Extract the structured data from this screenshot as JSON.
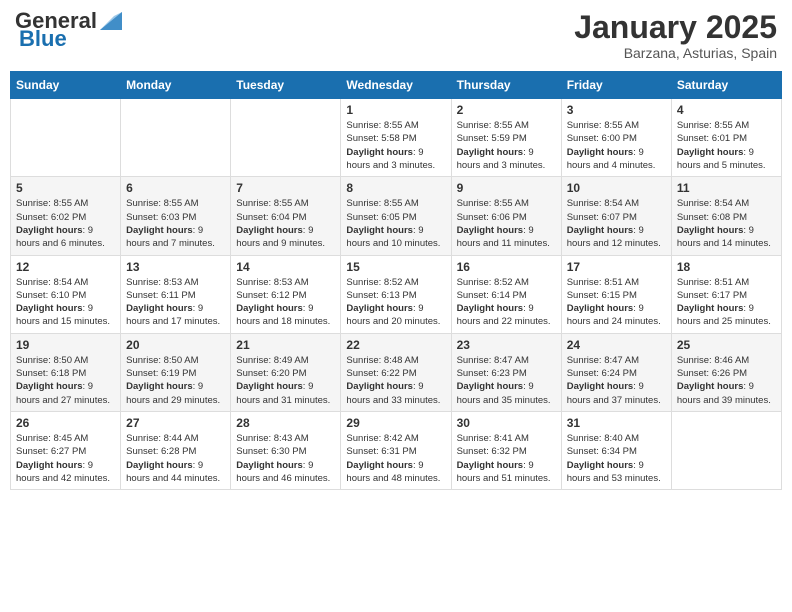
{
  "header": {
    "logo_general": "General",
    "logo_blue": "Blue",
    "month_title": "January 2025",
    "location": "Barzana, Asturias, Spain"
  },
  "calendar": {
    "days_of_week": [
      "Sunday",
      "Monday",
      "Tuesday",
      "Wednesday",
      "Thursday",
      "Friday",
      "Saturday"
    ],
    "weeks": [
      [
        {
          "day": "",
          "info": ""
        },
        {
          "day": "",
          "info": ""
        },
        {
          "day": "",
          "info": ""
        },
        {
          "day": "1",
          "info": "Sunrise: 8:55 AM\nSunset: 5:58 PM\nDaylight: 9 hours and 3 minutes."
        },
        {
          "day": "2",
          "info": "Sunrise: 8:55 AM\nSunset: 5:59 PM\nDaylight: 9 hours and 3 minutes."
        },
        {
          "day": "3",
          "info": "Sunrise: 8:55 AM\nSunset: 6:00 PM\nDaylight: 9 hours and 4 minutes."
        },
        {
          "day": "4",
          "info": "Sunrise: 8:55 AM\nSunset: 6:01 PM\nDaylight: 9 hours and 5 minutes."
        }
      ],
      [
        {
          "day": "5",
          "info": "Sunrise: 8:55 AM\nSunset: 6:02 PM\nDaylight: 9 hours and 6 minutes."
        },
        {
          "day": "6",
          "info": "Sunrise: 8:55 AM\nSunset: 6:03 PM\nDaylight: 9 hours and 7 minutes."
        },
        {
          "day": "7",
          "info": "Sunrise: 8:55 AM\nSunset: 6:04 PM\nDaylight: 9 hours and 9 minutes."
        },
        {
          "day": "8",
          "info": "Sunrise: 8:55 AM\nSunset: 6:05 PM\nDaylight: 9 hours and 10 minutes."
        },
        {
          "day": "9",
          "info": "Sunrise: 8:55 AM\nSunset: 6:06 PM\nDaylight: 9 hours and 11 minutes."
        },
        {
          "day": "10",
          "info": "Sunrise: 8:54 AM\nSunset: 6:07 PM\nDaylight: 9 hours and 12 minutes."
        },
        {
          "day": "11",
          "info": "Sunrise: 8:54 AM\nSunset: 6:08 PM\nDaylight: 9 hours and 14 minutes."
        }
      ],
      [
        {
          "day": "12",
          "info": "Sunrise: 8:54 AM\nSunset: 6:10 PM\nDaylight: 9 hours and 15 minutes."
        },
        {
          "day": "13",
          "info": "Sunrise: 8:53 AM\nSunset: 6:11 PM\nDaylight: 9 hours and 17 minutes."
        },
        {
          "day": "14",
          "info": "Sunrise: 8:53 AM\nSunset: 6:12 PM\nDaylight: 9 hours and 18 minutes."
        },
        {
          "day": "15",
          "info": "Sunrise: 8:52 AM\nSunset: 6:13 PM\nDaylight: 9 hours and 20 minutes."
        },
        {
          "day": "16",
          "info": "Sunrise: 8:52 AM\nSunset: 6:14 PM\nDaylight: 9 hours and 22 minutes."
        },
        {
          "day": "17",
          "info": "Sunrise: 8:51 AM\nSunset: 6:15 PM\nDaylight: 9 hours and 24 minutes."
        },
        {
          "day": "18",
          "info": "Sunrise: 8:51 AM\nSunset: 6:17 PM\nDaylight: 9 hours and 25 minutes."
        }
      ],
      [
        {
          "day": "19",
          "info": "Sunrise: 8:50 AM\nSunset: 6:18 PM\nDaylight: 9 hours and 27 minutes."
        },
        {
          "day": "20",
          "info": "Sunrise: 8:50 AM\nSunset: 6:19 PM\nDaylight: 9 hours and 29 minutes."
        },
        {
          "day": "21",
          "info": "Sunrise: 8:49 AM\nSunset: 6:20 PM\nDaylight: 9 hours and 31 minutes."
        },
        {
          "day": "22",
          "info": "Sunrise: 8:48 AM\nSunset: 6:22 PM\nDaylight: 9 hours and 33 minutes."
        },
        {
          "day": "23",
          "info": "Sunrise: 8:47 AM\nSunset: 6:23 PM\nDaylight: 9 hours and 35 minutes."
        },
        {
          "day": "24",
          "info": "Sunrise: 8:47 AM\nSunset: 6:24 PM\nDaylight: 9 hours and 37 minutes."
        },
        {
          "day": "25",
          "info": "Sunrise: 8:46 AM\nSunset: 6:26 PM\nDaylight: 9 hours and 39 minutes."
        }
      ],
      [
        {
          "day": "26",
          "info": "Sunrise: 8:45 AM\nSunset: 6:27 PM\nDaylight: 9 hours and 42 minutes."
        },
        {
          "day": "27",
          "info": "Sunrise: 8:44 AM\nSunset: 6:28 PM\nDaylight: 9 hours and 44 minutes."
        },
        {
          "day": "28",
          "info": "Sunrise: 8:43 AM\nSunset: 6:30 PM\nDaylight: 9 hours and 46 minutes."
        },
        {
          "day": "29",
          "info": "Sunrise: 8:42 AM\nSunset: 6:31 PM\nDaylight: 9 hours and 48 minutes."
        },
        {
          "day": "30",
          "info": "Sunrise: 8:41 AM\nSunset: 6:32 PM\nDaylight: 9 hours and 51 minutes."
        },
        {
          "day": "31",
          "info": "Sunrise: 8:40 AM\nSunset: 6:34 PM\nDaylight: 9 hours and 53 minutes."
        },
        {
          "day": "",
          "info": ""
        }
      ]
    ]
  }
}
